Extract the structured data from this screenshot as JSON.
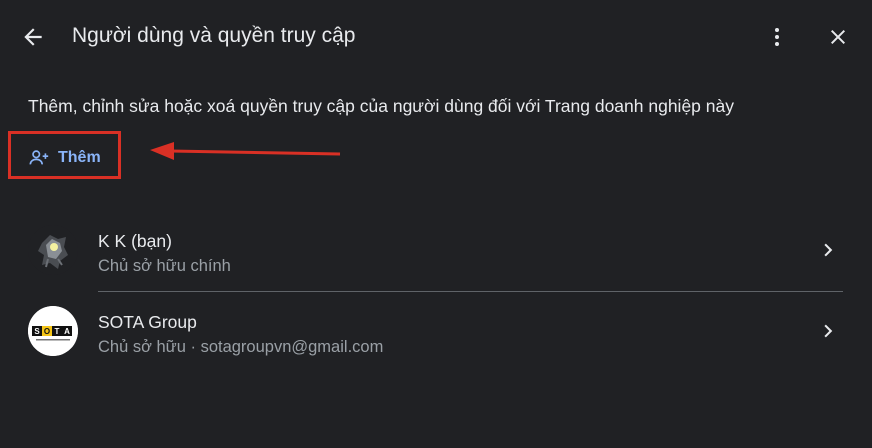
{
  "header": {
    "title": "Người dùng và quyền truy cập",
    "back_icon": "arrow-left-icon",
    "more_icon": "more-vert-icon",
    "close_icon": "close-icon"
  },
  "description": "Thêm, chỉnh sửa hoặc xoá quyền truy cập của người dùng đối với Trang doanh nghiệp này",
  "add_button": {
    "label": "Thêm",
    "icon": "person-add-icon"
  },
  "annotation": {
    "highlight_color": "#d93025"
  },
  "users": [
    {
      "name": "K K (bạn)",
      "role": "Chủ sở hữu chính",
      "avatar_icon": "profile-avatar"
    },
    {
      "name": "SOTA Group",
      "role": "Chủ sở hữu · sotagroupvn@gmail.com",
      "avatar_icon": "sota-logo",
      "avatar_text": "SOTA"
    }
  ],
  "colors": {
    "background": "#202124",
    "text": "#e8eaed",
    "secondary_text": "#9aa0a6",
    "accent": "#8ab4f8",
    "divider": "#5f6368"
  }
}
